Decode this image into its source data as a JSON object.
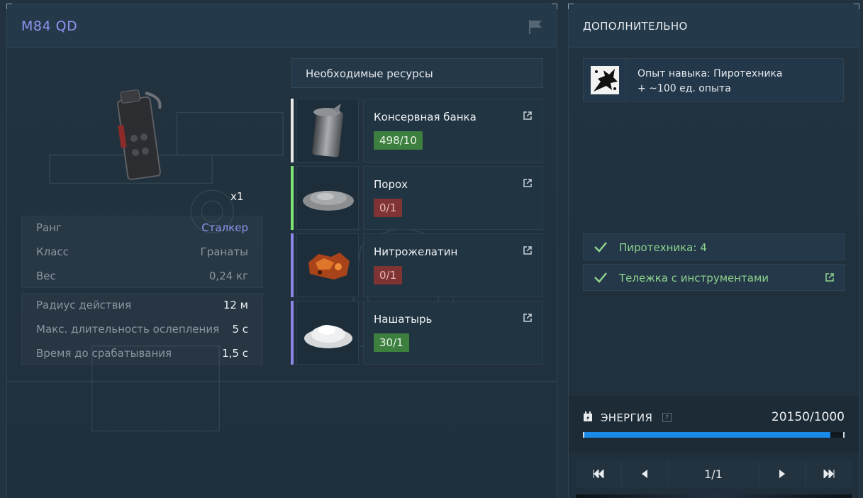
{
  "item": {
    "title": "M84 QD",
    "quantity": "x1",
    "stats_main": [
      {
        "label": "Ранг",
        "value": "Сталкер",
        "kind": "rank"
      },
      {
        "label": "Класс",
        "value": "Гранаты",
        "kind": "dim"
      },
      {
        "label": "Вес",
        "value": "0,24 кг",
        "kind": "dim"
      }
    ],
    "stats_extra": [
      {
        "label": "Радиус действия",
        "value": "12 м"
      },
      {
        "label": "Макс. длительность ослепления",
        "value": "5 с"
      },
      {
        "label": "Время до срабатывания",
        "value": "1,5 с"
      }
    ]
  },
  "resources": {
    "header": "Необходимые ресурсы",
    "items": [
      {
        "name": "Консервная банка",
        "count": "498/10",
        "ok": true,
        "bar_color": "#e8e8e8",
        "icon": "tin-can-icon"
      },
      {
        "name": "Порох",
        "count": "0/1",
        "ok": false,
        "bar_color": "#7fe36f",
        "icon": "gunpowder-icon"
      },
      {
        "name": "Нитрожелатин",
        "count": "0/1",
        "ok": false,
        "bar_color": "#8c86e8",
        "icon": "nitrogelatin-icon"
      },
      {
        "name": "Нашатырь",
        "count": "30/1",
        "ok": true,
        "bar_color": "#8c86e8",
        "icon": "ammonia-icon"
      }
    ]
  },
  "extra": {
    "title": "ДОПОЛНИТЕЛЬНО",
    "skill_line1": "Опыт навыка: Пиротехника",
    "skill_line2": "+ ~100 ед. опыта",
    "requirements": [
      {
        "label": "Пиротехника: 4",
        "link": false
      },
      {
        "label": "Тележка с инструментами",
        "link": true
      }
    ]
  },
  "energy": {
    "label": "ЭНЕРГИЯ",
    "help": "?",
    "value": "20150/1000",
    "fill_fraction": 0.95
  },
  "pager": {
    "label": "1/1"
  }
}
